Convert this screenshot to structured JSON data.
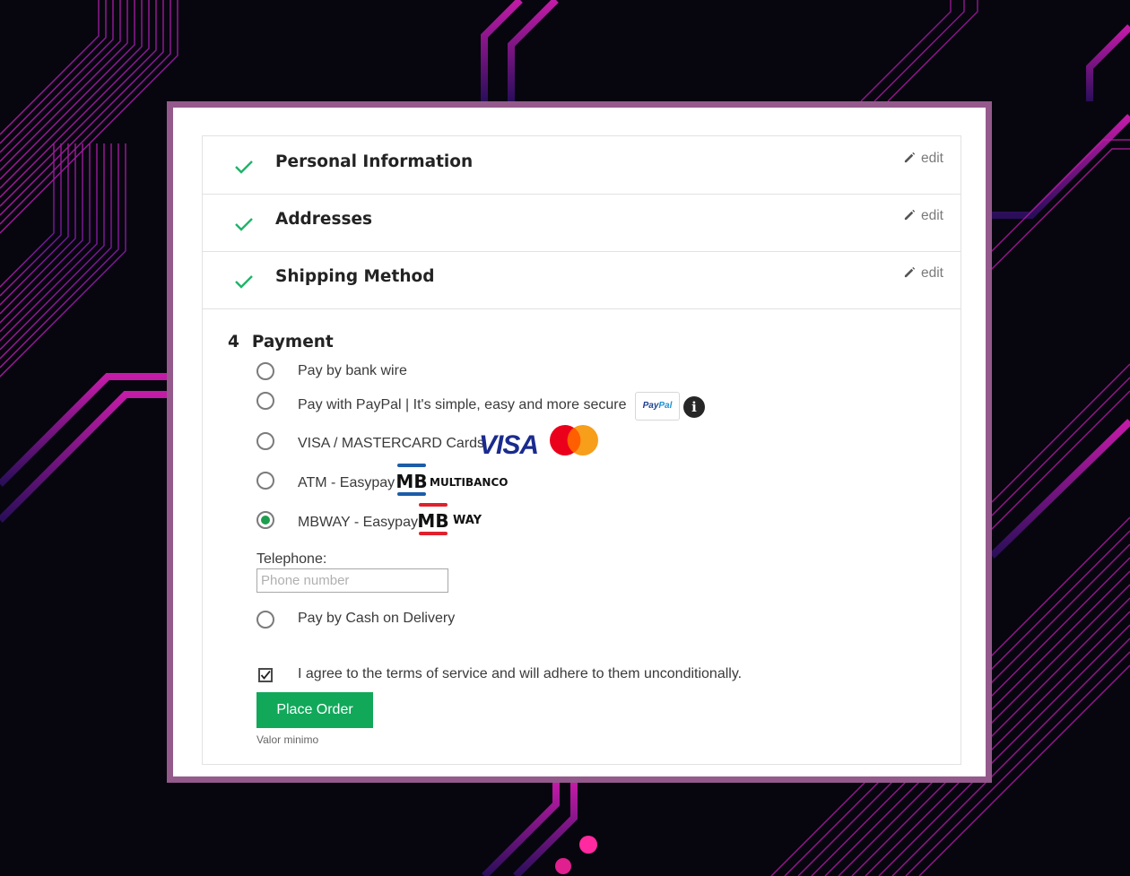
{
  "steps": [
    {
      "title": "Personal Information",
      "edit": "edit"
    },
    {
      "title": "Addresses",
      "edit": "edit"
    },
    {
      "title": "Shipping Method",
      "edit": "edit"
    }
  ],
  "payment": {
    "number": "4",
    "title": "Payment",
    "options": [
      {
        "label": "Pay by bank wire",
        "selected": false
      },
      {
        "label": "Pay with PayPal | It's simple, easy and more secure",
        "selected": false,
        "logo": "PayPal",
        "logo_part1": "Pay",
        "logo_part2": "Pal",
        "icon": "info-icon"
      },
      {
        "label": "VISA / MASTERCARD Cards",
        "selected": false,
        "logos": [
          "VISA",
          "mastercard-icon"
        ]
      },
      {
        "label": "ATM - Easypay",
        "selected": false,
        "logo": "MULTIBANCO"
      },
      {
        "label": "MBWAY - Easypay",
        "selected": true,
        "logo": "WAY"
      },
      {
        "label": "Pay by Cash on Delivery",
        "selected": false
      }
    ],
    "telephone_label": "Telephone:",
    "telephone_placeholder": "Phone number"
  },
  "terms": {
    "label": "I agree to the terms of service and will adhere to them unconditionally.",
    "checked": true
  },
  "place_order": "Place Order",
  "min_value": "Valor minimo",
  "colors": {
    "accent": "#11a85a",
    "frame": "#955a8c",
    "check": "#1fb46a",
    "background": "#07060f"
  }
}
